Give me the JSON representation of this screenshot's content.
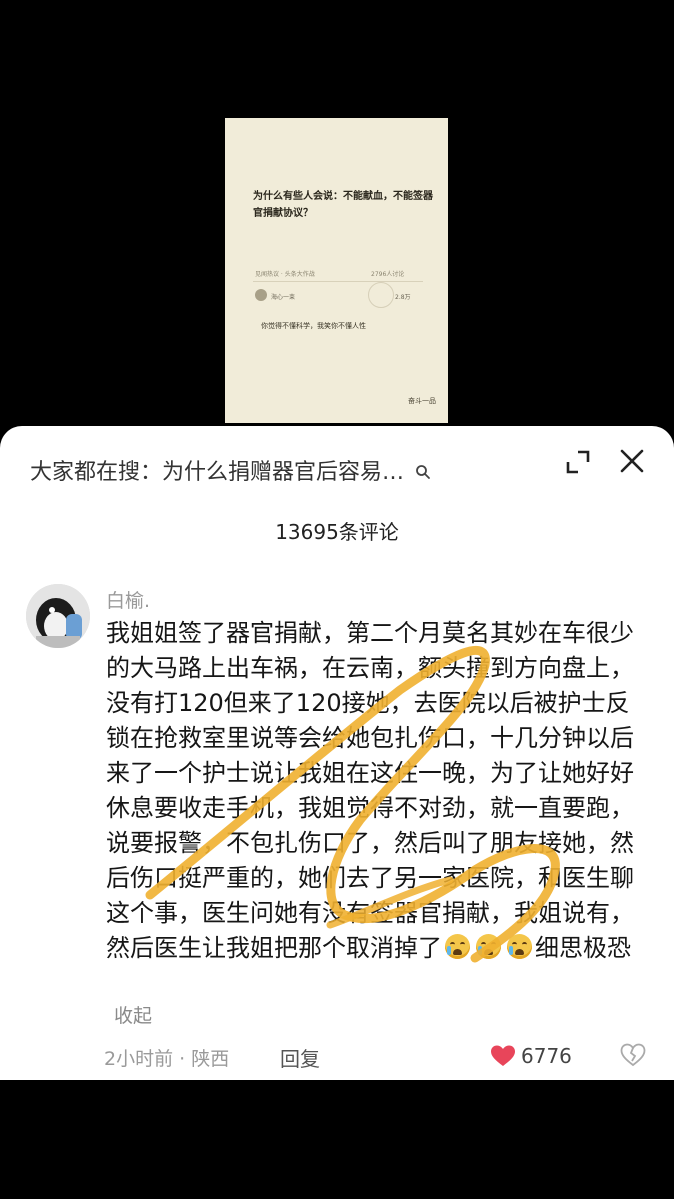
{
  "thumbnail": {
    "question": "为什么有些人会说：不能献血，不能签器官捐献协议？",
    "meta_left": "见闻热议 · 头条大作战",
    "meta_right": "2796人讨论",
    "comment_user": "海心一束",
    "comment_likes": "2.8万",
    "comment": "你觉得不懂科学，我笑你不懂人性",
    "logo": "奋斗一品"
  },
  "header": {
    "search_title": "大家都在搜：为什么捐赠器官后容易…",
    "search_icon": "search-icon",
    "expand_icon": "expand-icon",
    "close_icon": "close-icon"
  },
  "comments_count": "13695条评论",
  "comment": {
    "username": "白榆.",
    "text_main": "我姐姐签了器官捐献，第二个月莫名其妙在车很少的大马路上出车祸，在云南，额头撞到方向盘上，没有打120但来了120接她，去医院以后被护士反锁在抢救室里说等会给她包扎伤口，十几分钟以后来了一个护士说让我姐在这住一晚，为了让她好好休息要收走手机，我姐觉得不对劲，就一直要跑，说要报警，不包扎伤口了，然后叫了朋友接她，然后伤口挺严重的，她们去了另一家医院，和医生聊这个事，医生问她有没有签器官捐献，我姐说有，然后医生让我姐把那个取消掉了",
    "text_tail": "细思极恐",
    "emoji_name": "crying-face-emoji",
    "collapse_label": "收起",
    "time_location": "2小时前 · 陕西",
    "reply_label": "回复",
    "like_count": "6776"
  },
  "colors": {
    "background": "#000000",
    "sheet": "#ffffff",
    "like_heart": "#e8455a",
    "scribble": "#f0b030"
  }
}
